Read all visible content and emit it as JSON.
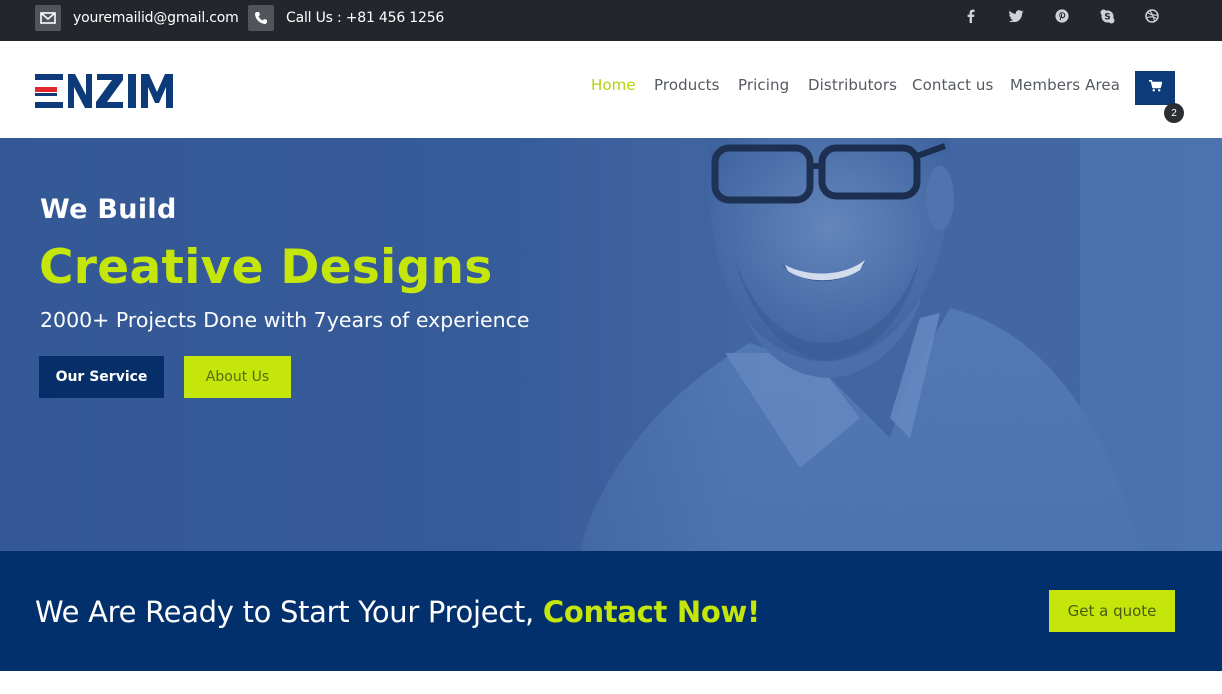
{
  "topbar": {
    "email": "youremailid@gmail.com",
    "phone": "Call Us : +81 456 1256",
    "social": [
      "facebook-icon",
      "twitter-icon",
      "pinterest-icon",
      "skype-icon",
      "dribbble-icon"
    ]
  },
  "header": {
    "logo_text": "ENZIM",
    "nav": [
      {
        "label": "Home",
        "active": true
      },
      {
        "label": "Products",
        "active": false
      },
      {
        "label": "Pricing",
        "active": false
      },
      {
        "label": "Distributors",
        "active": false
      },
      {
        "label": "Contact us",
        "active": false
      },
      {
        "label": "Members Area",
        "active": false
      }
    ],
    "cart_count": "2"
  },
  "hero": {
    "pre_title": "We Build",
    "title": "Creative Designs",
    "subtitle": "2000+ Projects Done with 7years of experience",
    "primary_button": "Our Service",
    "secondary_button": "About Us"
  },
  "cta": {
    "text": "We Are Ready to Start Your Project, ",
    "highlight": "Contact Now!",
    "button": "Get a quote"
  },
  "colors": {
    "accent": "#c5e60b",
    "brand_navy": "#02306c",
    "topbar": "#23262d"
  }
}
